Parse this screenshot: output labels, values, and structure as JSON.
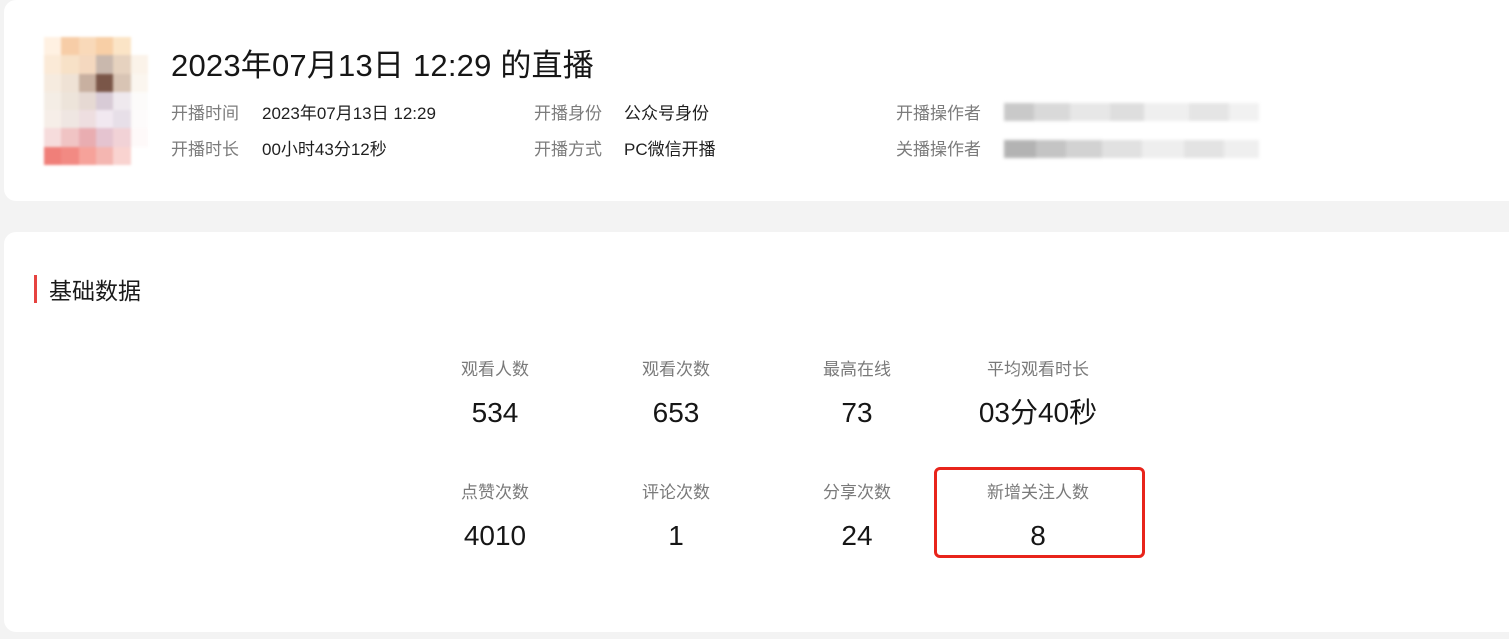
{
  "live": {
    "title": "2023年07月13日 12:29 的直播",
    "start_time_label": "开播时间",
    "start_time_value": "2023年07月13日 12:29",
    "duration_label": "开播时长",
    "duration_value": "00小时43分12秒",
    "identity_label": "开播身份",
    "identity_value": "公众号身份",
    "method_label": "开播方式",
    "method_value": "PC微信开播",
    "start_operator_label": "开播操作者",
    "end_operator_label": "关播操作者"
  },
  "basic_data": {
    "section_title": "基础数据",
    "accent_color": "#e64340",
    "highlight_color": "#e8241b",
    "row1": [
      {
        "label": "观看人数",
        "value": "534"
      },
      {
        "label": "观看次数",
        "value": "653"
      },
      {
        "label": "最高在线",
        "value": "73"
      },
      {
        "label": "平均观看时长",
        "value": "03分40秒"
      }
    ],
    "row2": [
      {
        "label": "点赞次数",
        "value": "4010"
      },
      {
        "label": "评论次数",
        "value": "1"
      },
      {
        "label": "分享次数",
        "value": "24"
      },
      {
        "label": "新增关注人数",
        "value": "8"
      }
    ]
  }
}
